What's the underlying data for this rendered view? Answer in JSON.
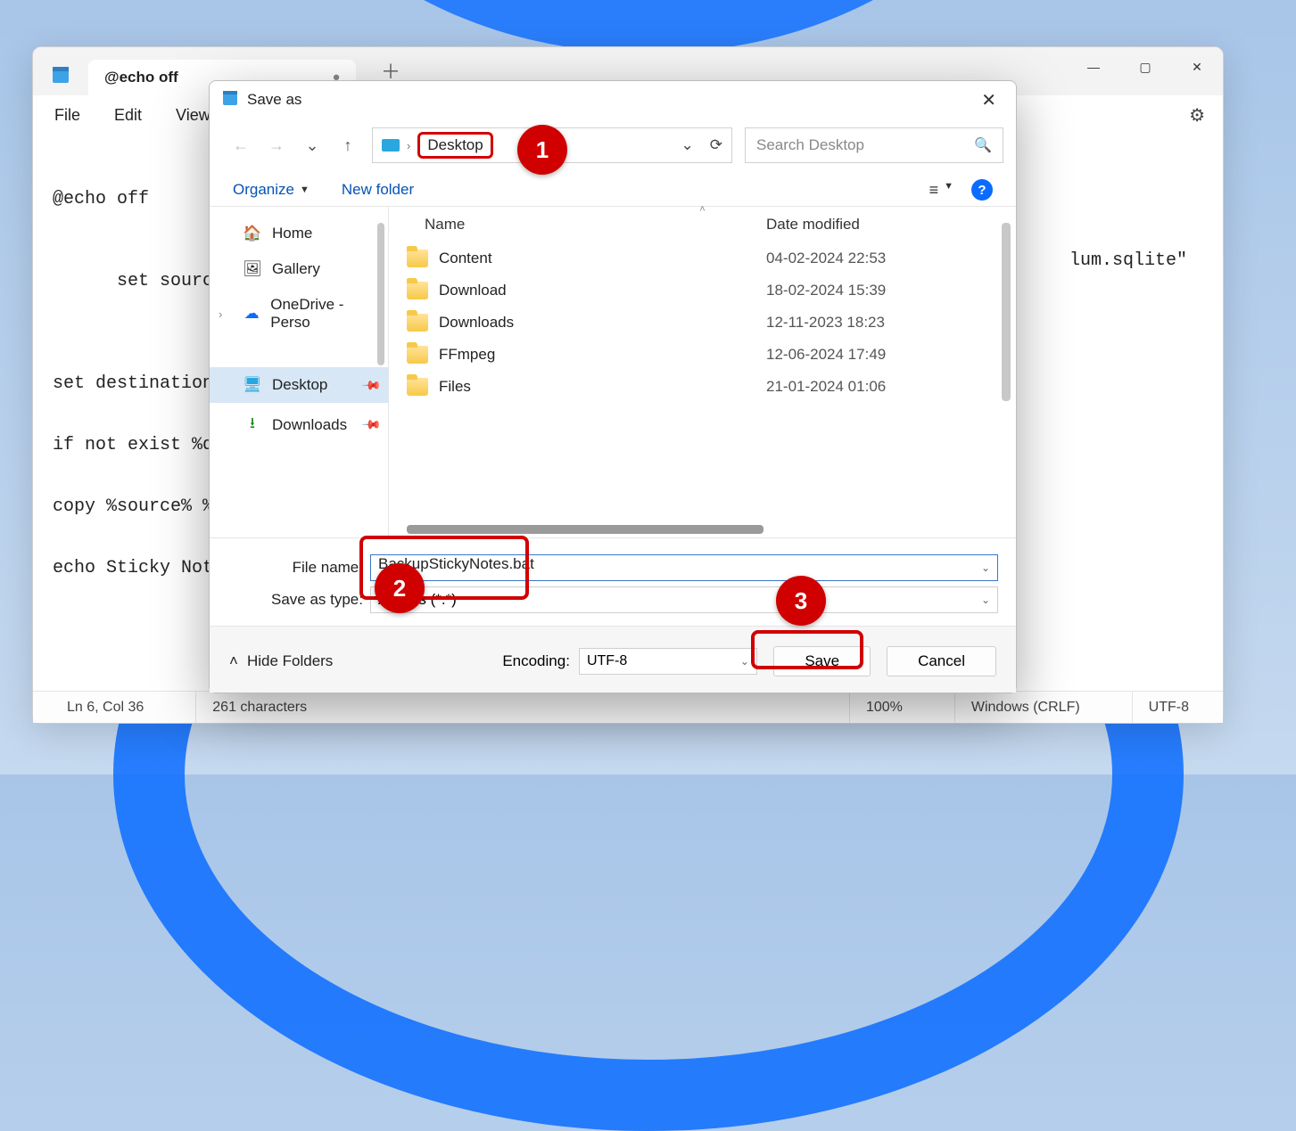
{
  "notepad": {
    "tab_title": "@echo off",
    "menu": {
      "file": "File",
      "edit": "Edit",
      "view": "View"
    },
    "content_lines": [
      "@echo off",
      "set source=\"%Lo",
      "set destination",
      "if not exist %d",
      "copy %source% %",
      "echo Sticky Not"
    ],
    "tail_fragment": "lum.sqlite\"",
    "status": {
      "pos": "Ln 6, Col 36",
      "chars": "261 characters",
      "zoom": "100%",
      "eol": "Windows (CRLF)",
      "enc": "UTF-8"
    }
  },
  "saveas": {
    "title": "Save as",
    "breadcrumb": "Desktop",
    "search_placeholder": "Search Desktop",
    "toolbar": {
      "organize": "Organize",
      "newfolder": "New folder"
    },
    "nav": {
      "home": "Home",
      "gallery": "Gallery",
      "onedrive": "OneDrive - Perso",
      "desktop": "Desktop",
      "downloads": "Downloads"
    },
    "columns": {
      "name": "Name",
      "date": "Date modified"
    },
    "rows": [
      {
        "name": "Content",
        "date": "04-02-2024 22:53"
      },
      {
        "name": "Download",
        "date": "18-02-2024 15:39"
      },
      {
        "name": "Downloads",
        "date": "12-11-2023 18:23"
      },
      {
        "name": "FFmpeg",
        "date": "12-06-2024 17:49"
      },
      {
        "name": "Files",
        "date": "21-01-2024 01:06"
      }
    ],
    "labels": {
      "filename": "File name:",
      "savetype": "Save as type:",
      "encoding": "Encoding:",
      "hidefolders": "Hide Folders"
    },
    "filename_value": "BackupStickyNotes.bat",
    "savetype_value": "All files  (*.*)",
    "encoding_value": "UTF-8",
    "buttons": {
      "save": "Save",
      "cancel": "Cancel"
    }
  },
  "callouts": {
    "one": "1",
    "two": "2",
    "three": "3"
  }
}
